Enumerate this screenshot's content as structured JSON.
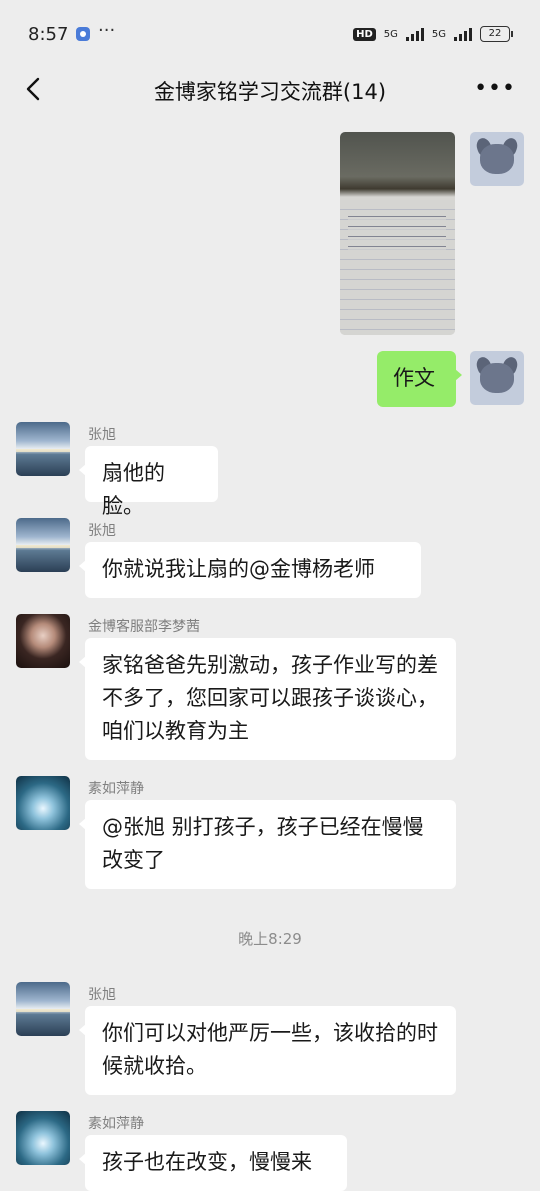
{
  "status_bar": {
    "time": "8:57",
    "net1": "5G",
    "net2": "5G",
    "hd": "HD",
    "battery": "22"
  },
  "header": {
    "title": "金博家铭学习交流群(14)"
  },
  "messages": [
    {
      "from": "me",
      "type": "image"
    },
    {
      "from": "me",
      "text": "作文"
    },
    {
      "from": "张旭",
      "text": "扇他的脸。"
    },
    {
      "from": "张旭",
      "text": "你就说我让扇的@金博杨老师"
    },
    {
      "from": "金博客服部李梦茜",
      "text": "家铭爸爸先别激动，孩子作业写的差不多了，您回家可以跟孩子谈谈心，咱们以教育为主"
    },
    {
      "from": "素如萍静",
      "text": "@张旭  别打孩子，孩子已经在慢慢改变了"
    },
    {
      "type": "timestamp",
      "text": "晚上8:29"
    },
    {
      "from": "张旭",
      "text": "你们可以对他严厉一些，该收拾的时候就收拾。"
    },
    {
      "from": "素如萍静",
      "text": "孩子也在改变，慢慢来"
    }
  ],
  "colors": {
    "background": "#ededed",
    "my_bubble": "#95ec69",
    "other_bubble": "#ffffff"
  },
  "icons": {
    "back": "chevron-left-icon",
    "more": "more-icon"
  }
}
